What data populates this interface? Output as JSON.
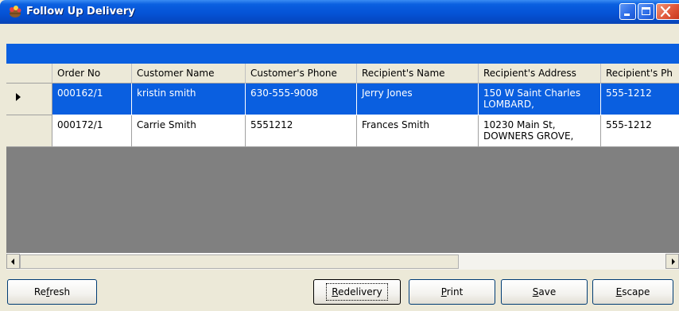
{
  "window": {
    "title": "Follow Up Delivery",
    "icon": "flower-basket-icon",
    "controls": [
      "minimize-icon",
      "maximize-icon",
      "close-icon"
    ]
  },
  "grid": {
    "columns": [
      "Order No",
      "Customer Name",
      "Customer's Phone",
      "Recipient's Name",
      "Recipient's Address",
      "Recipient's Ph"
    ],
    "rows": [
      {
        "selected": true,
        "cells": [
          "000162/1",
          "kristin smith",
          "630-555-9008",
          "Jerry Jones",
          "150 W Saint Charles\nLOMBARD,",
          "555-1212"
        ]
      },
      {
        "selected": false,
        "cells": [
          "000172/1",
          "Carrie Smith",
          "5551212",
          "Frances Smith",
          "10230 Main St,\nDOWNERS GROVE,",
          "555-1212"
        ]
      }
    ]
  },
  "buttons": {
    "refresh": {
      "pre": "Re",
      "key": "f",
      "post": "resh"
    },
    "redelivery": {
      "pre": "",
      "key": "R",
      "post": "edelivery"
    },
    "print": {
      "pre": "",
      "key": "P",
      "post": "rint"
    },
    "save": {
      "pre": "",
      "key": "S",
      "post": "ave"
    },
    "escape": {
      "pre": "",
      "key": "E",
      "post": "scape"
    }
  },
  "colors": {
    "selection": "#0a5fe0",
    "grid_background": "#808080",
    "title_bar": "#0553d6"
  }
}
